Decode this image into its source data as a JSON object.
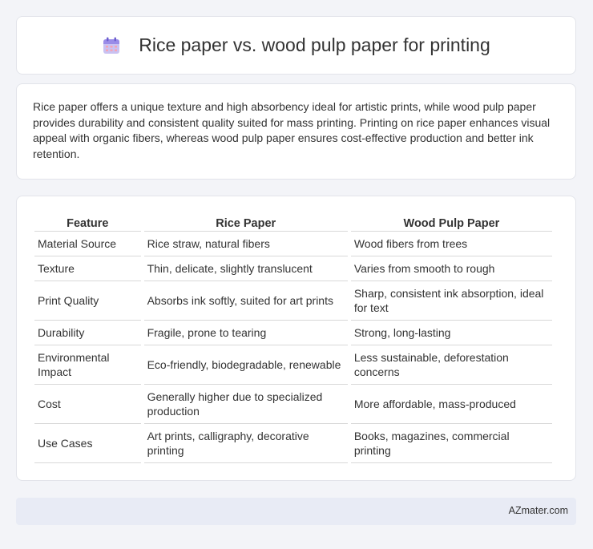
{
  "header": {
    "title": "Rice paper vs. wood pulp paper for printing",
    "icon": "calendar-icon"
  },
  "summary": {
    "text": "Rice paper offers a unique texture and high absorbency ideal for artistic prints, while wood pulp paper provides durability and consistent quality suited for mass printing. Printing on rice paper enhances visual appeal with organic fibers, whereas wood pulp paper ensures cost-effective production and better ink retention."
  },
  "table": {
    "headers": [
      "Feature",
      "Rice Paper",
      "Wood Pulp Paper"
    ],
    "rows": [
      [
        "Material Source",
        "Rice straw, natural fibers",
        "Wood fibers from trees"
      ],
      [
        "Texture",
        "Thin, delicate, slightly translucent",
        "Varies from smooth to rough"
      ],
      [
        "Print Quality",
        "Absorbs ink softly, suited for art prints",
        "Sharp, consistent ink absorption, ideal for text"
      ],
      [
        "Durability",
        "Fragile, prone to tearing",
        "Strong, long-lasting"
      ],
      [
        "Environmental Impact",
        "Eco-friendly, biodegradable, renewable",
        "Less sustainable, deforestation concerns"
      ],
      [
        "Cost",
        "Generally higher due to specialized production",
        "More affordable, mass-produced"
      ],
      [
        "Use Cases",
        "Art prints, calligraphy, decorative printing",
        "Books, magazines, commercial printing"
      ]
    ]
  },
  "footer": {
    "brand": "AZmater.com"
  },
  "colors": {
    "background": "#f3f4f8",
    "card": "#ffffff",
    "footer_bg": "#e8ebf5",
    "icon_accent": "#8c7ae6"
  }
}
